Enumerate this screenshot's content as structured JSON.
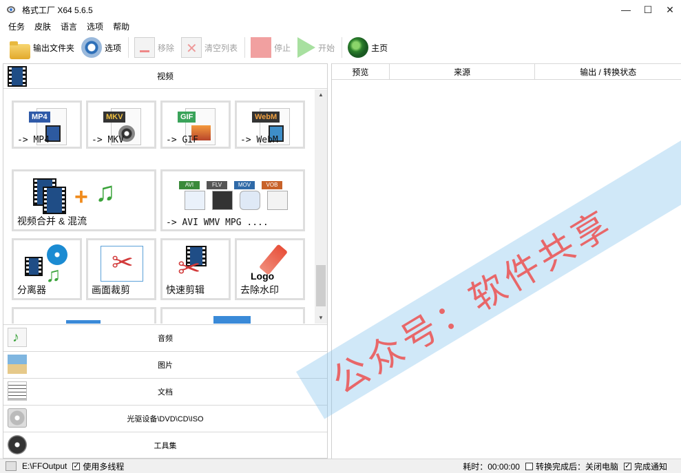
{
  "window": {
    "title": "格式工厂 X64 5.6.5",
    "min": "—",
    "max": "☐",
    "close": "✕"
  },
  "menu": [
    "任务",
    "皮肤",
    "语言",
    "选项",
    "帮助"
  ],
  "toolbar": {
    "output_folder": "输出文件夹",
    "options": "选项",
    "remove": "移除",
    "clear_list": "清空列表",
    "stop": "停止",
    "start": "开始",
    "home": "主页"
  },
  "left": {
    "video_header": "视频",
    "tiles": [
      {
        "badge": "MP4",
        "badge_color": "#2f5aa8",
        "label": "-> MP4"
      },
      {
        "badge": "MKV",
        "badge_color": "#333333",
        "label": "-> MKV"
      },
      {
        "badge": "GIF",
        "badge_color": "#3aa35a",
        "label": "-> GIF"
      },
      {
        "badge": "WebM",
        "badge_color": "#333333",
        "label": "-> WebM"
      }
    ],
    "merge_label": "视频合并 & 混流",
    "multi_label": "-> AVI WMV MPG ....",
    "multi_badges": [
      "AVI",
      "FLV",
      "MOV",
      "VOB"
    ],
    "splitter_label": "分离器",
    "crop_label": "画面裁剪",
    "quickcut_label": "快速剪辑",
    "logo_text": "Logo",
    "watermark_label": "去除水印",
    "categories": [
      "音频",
      "图片",
      "文档",
      "光驱设备\\DVD\\CD\\ISO",
      "工具集"
    ]
  },
  "right": {
    "columns": [
      "预览",
      "来源",
      "输出 / 转换状态"
    ]
  },
  "status": {
    "path": "E:\\FFOutput",
    "multithread": "使用多线程",
    "elapsed": "耗时：00:00:00",
    "after_done": "转换完成后：关闭电脑",
    "notify": "完成通知"
  },
  "overlay_watermark": "公众号：软件共享"
}
